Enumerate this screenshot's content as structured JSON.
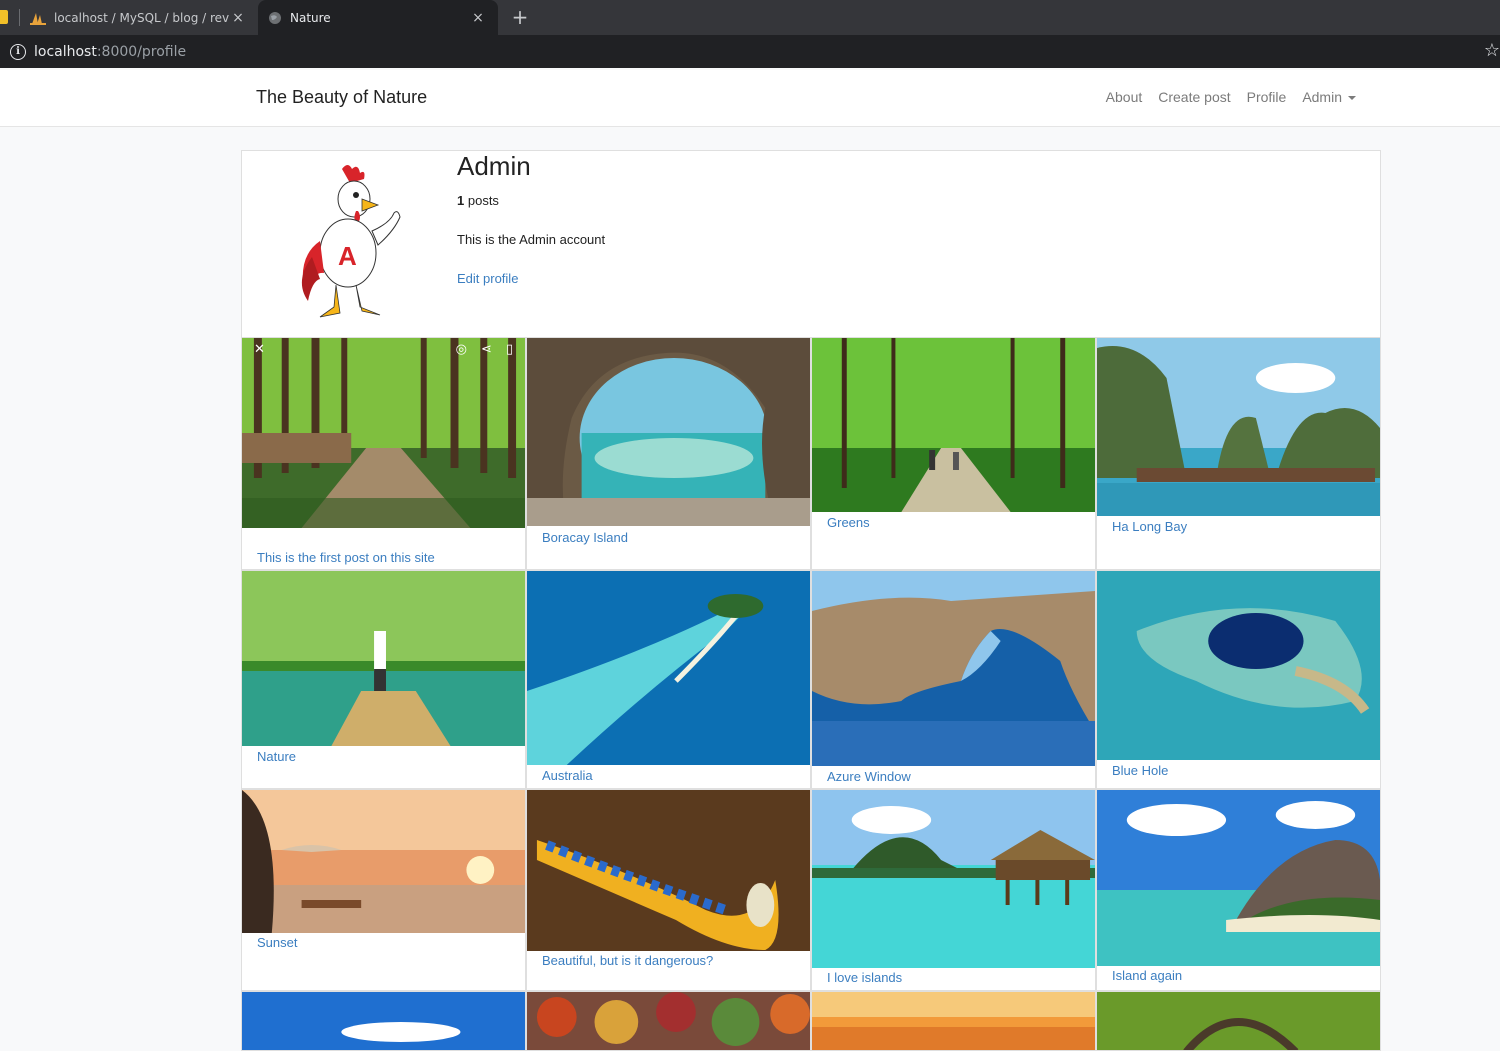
{
  "browser": {
    "tabs": [
      {
        "title": "localhost / MySQL / blog / review",
        "close": "×"
      },
      {
        "title": "Nature",
        "close": "×"
      }
    ],
    "new_tab": "+",
    "address_host": "localhost",
    "address_rest": ":8000/profile",
    "info_icon": "i",
    "star_icon": "☆"
  },
  "navbar": {
    "brand": "The Beauty of Nature",
    "links": [
      "About",
      "Create post",
      "Profile",
      "Admin"
    ]
  },
  "profile": {
    "name": "Admin",
    "posts_count": "1",
    "posts_label": "posts",
    "bio": "This is the Admin account",
    "edit_label": "Edit profile"
  },
  "posts": [
    {
      "caption": "This is the first post on this site",
      "image": "forest-path"
    },
    {
      "caption": "Boracay Island",
      "image": "sea-cave"
    },
    {
      "caption": "Greens",
      "image": "green-forest-walk"
    },
    {
      "caption": "Ha Long Bay",
      "image": "limestone-bay"
    },
    {
      "caption": "Nature",
      "image": "bamboo-raft-river"
    },
    {
      "caption": "Australia",
      "image": "island-sandbar"
    },
    {
      "caption": "Azure Window",
      "image": "rock-arch"
    },
    {
      "caption": "Blue Hole",
      "image": "blue-hole"
    },
    {
      "caption": "Sunset",
      "image": "beach-sunset"
    },
    {
      "caption": "Beautiful, but is it dangerous?",
      "image": "sea-slug"
    },
    {
      "caption": "I love islands",
      "image": "overwater-bungalow"
    },
    {
      "caption": "Island again",
      "image": "granite-beach"
    },
    {
      "caption": "",
      "image": "sky-sea"
    },
    {
      "caption": "",
      "image": "autumn-trees"
    },
    {
      "caption": "",
      "image": "sunset-sky"
    },
    {
      "caption": "",
      "image": "forest-bridge"
    }
  ]
}
